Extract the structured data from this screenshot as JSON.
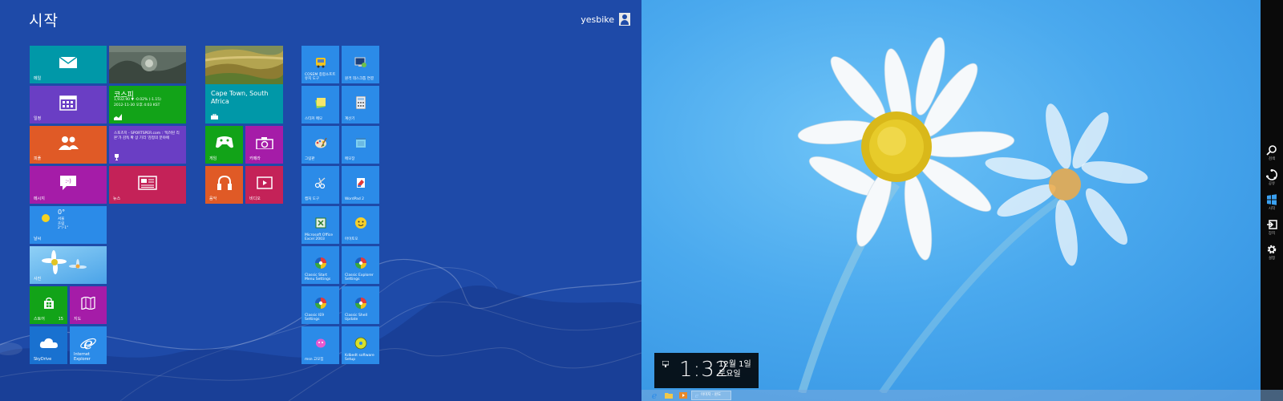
{
  "start": {
    "title": "시작",
    "user": "yesbike"
  },
  "tiles": {
    "mail": "메일",
    "calendar": "일정",
    "people": "피플",
    "messaging": "메시지",
    "news": "뉴스",
    "weather_label": "날씨",
    "weather": {
      "temp": "0°",
      "city": "서울",
      "cond": "흐림",
      "range": "2°/-1°"
    },
    "photos": "사진",
    "store": "스토어",
    "store_badge": "15",
    "maps": "지도",
    "skydrive": "SkyDrive",
    "ie": "Internet Explorer",
    "kospi": {
      "name": "코스피",
      "line1": "1,932.90  ▼ -0.02% (-1.15)",
      "line2": "2012-11-30 오후 4:03 KST"
    },
    "sports": "스포츠지 - SPORTSPER.com : '독려된 리\n몬'가 감독 확 상 기리 '감정의 분야에",
    "travel": "Cape Town, South Africa",
    "games": "게임",
    "camera": "카메라",
    "music": "음악",
    "video": "비디오",
    "apps_col1": [
      "COSEM 종합소프트 유지 도구",
      "스티커 메모",
      "그림판",
      "캡처 도구",
      "Microsoft Office Excel 2003",
      "Classic Start Menu Settings",
      "Classic IE9 Settings",
      "msn 고모집"
    ],
    "apps_col2": [
      "원격 데스크톱 연결",
      "계산기",
      "메모장",
      "WordPad 2",
      "아이토오",
      "Classic Explorer Settings",
      "Classic Shell Update",
      "Kdbedt software Setup"
    ]
  },
  "desktop": {
    "clock": {
      "time": "1:32",
      "date_line1": "12월 1일",
      "date_line2": "토요일"
    },
    "taskbar_window": "이미지 - 윈도"
  },
  "charms": {
    "search": "검색",
    "share": "공유",
    "start": "시작",
    "devices": "장치",
    "settings": "설정"
  },
  "colors": {
    "start_bg": "#1e4aa8",
    "tile_teal": "#0098a8",
    "tile_purple": "#6a3ec4",
    "tile_orange": "#e05a26",
    "tile_magenta": "#a51ca8",
    "tile_red": "#c42258",
    "tile_green": "#12a318",
    "tile_blue": "#2b8be8"
  }
}
